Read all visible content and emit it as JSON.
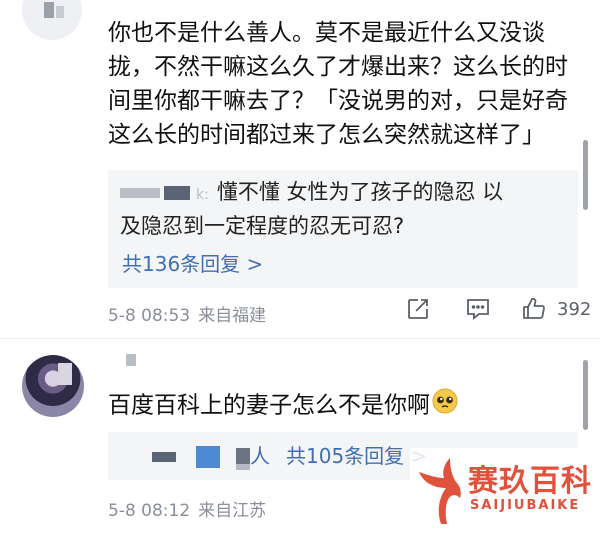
{
  "comments": [
    {
      "text": "你也不是什么善人。莫不是最近什么又没谈拢，不然干嘛这么久了才爆出来？这么长的时间里你都干嘛去了？「没说男的对，只是好奇这么长的时间都过来了怎么突然就这样了」",
      "reply": {
        "user_fragment": "k:",
        "line1": "懂不懂 女性为了孩子的隐忍 以",
        "line2": "及隐忍到一定程度的忍无可忍?",
        "more": "共136条回复 >"
      },
      "date": "5-8 08:53",
      "location": "来自福建",
      "likes": "392"
    },
    {
      "text": "百度百科上的妻子怎么不是你啊",
      "emoji": "pleading-face-emoji",
      "reply": {
        "user_fragment": "人",
        "more": "共105条回复 >"
      },
      "date": "5-8 08:12",
      "location": "来自江苏"
    }
  ],
  "icons": {
    "share": "share-icon",
    "comment": "comment-icon",
    "like": "like-icon"
  },
  "watermark": {
    "title": "赛玖百科",
    "subtitle": "SAIJIUBAIKE"
  },
  "colors": {
    "link": "#3f6fb5",
    "meta": "#8a8f97",
    "reply_bg": "#f4f5f7",
    "watermark": "#e1523d"
  }
}
